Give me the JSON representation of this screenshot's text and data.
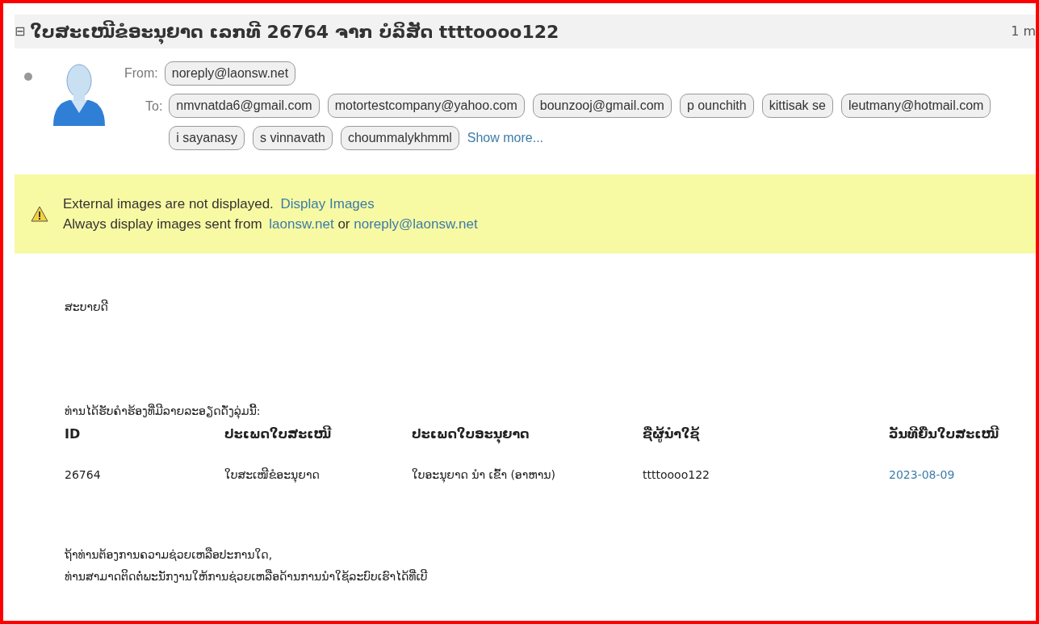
{
  "message": {
    "collapse_icon": "⊟",
    "subject": "ໃບສະເໜີຂໍອະນຸຍາດ ເລກທີ 26764 ຈາກ ບໍລິສັດ ttttoooo122",
    "time": "1 m",
    "from_label": "From:",
    "from": [
      "noreply@laonsw.net"
    ],
    "to_label": "To:",
    "to": [
      "nmvnatda6@gmail.com",
      "motortestcompany@yahoo.com",
      "bounzooj@gmail.com",
      "p ounchith",
      "kittisak se",
      "leutmany@hotmail.com",
      "i sayanasy",
      "s vinnavath",
      "choummalykhmml"
    ],
    "show_more": "Show more..."
  },
  "notice": {
    "line1": "External images are not displayed.",
    "display_link": "Display Images",
    "line2": "Always display images sent from",
    "domain_link": "laonsw.net",
    "or": "or",
    "sender_link": "noreply@laonsw.net"
  },
  "body": {
    "greeting": "ສະບາຍດີ",
    "intro": "ທ່ານໄດ້ຮັບຄຳຮ້ອງທີ່ມີລາຍລະອຽດດັ່ງລຸ່ມນີ້:",
    "table": {
      "columns": [
        "ID",
        "ປະເພດໃບສະເໜີ",
        "ປະເພດໃບອະນຸຍາດ",
        "ຊື່ຜູ້ນຳໃຊ້",
        "ວັນທີຍື່ນໃບສະເໜີ"
      ],
      "rows": [
        {
          "cells": [
            "26764",
            "ໃບສະເໜີຂໍອະນຸຍາດ",
            "ໃບອະນຸຍາດ ນຳ ເຂົ້າ (ອາຫານ)",
            "ttttoooo122",
            "2023-08-09"
          ]
        }
      ]
    },
    "footer": [
      "ຖ້າທ່ານຕ້ອງການຄວາມຊ່ວຍເຫລືອປະການໃດ,",
      "ທ່ານສາມາດຕິດຕໍ່ພະນັກງານໃຫ້ການຊ່ວຍເຫລືອດ້ານການນຳໃຊ້ລະບົບເຮົາໄດ້ທີ່ເບີ"
    ]
  }
}
